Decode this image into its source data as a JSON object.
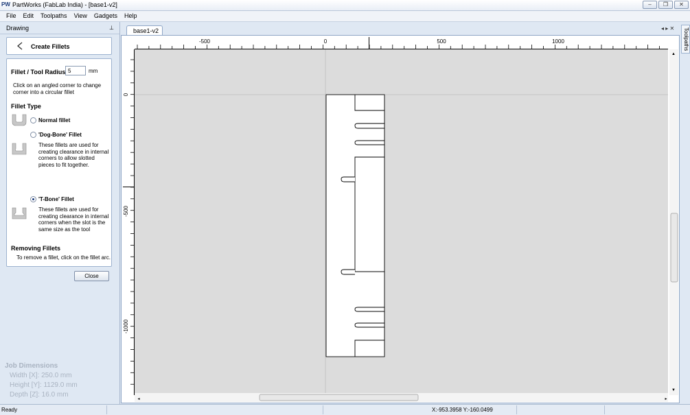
{
  "window": {
    "icon": "PW",
    "title": "PartWorks (FabLab India) - [base1-v2]",
    "buttons": [
      "–",
      "❐",
      "✕"
    ]
  },
  "menu": [
    "File",
    "Edit",
    "Toolpaths",
    "View",
    "Gadgets",
    "Help"
  ],
  "panel": {
    "header": "Drawing",
    "section_title": "Create Fillets",
    "radius_label": "Fillet / Tool Radius:",
    "radius_value": "5",
    "radius_unit": "mm",
    "instruction": "Click on an angled corner to change corner into a circular fillet",
    "fillet_type_title": "Fillet Type",
    "options": [
      {
        "label": "Normal fillet",
        "selected": false,
        "description": ""
      },
      {
        "label": "'Dog-Bone' Fillet",
        "selected": false,
        "description": "These fillets are used for creating clearance in internal corners to allow slotted pieces to fit together."
      },
      {
        "label": "'T-Bone' Fillet",
        "selected": true,
        "description": "These fillets are used for creating clearance in internal corners when the slot is the same size as the tool"
      }
    ],
    "removing_title": "Removing Fillets",
    "removing_text": "To remove a fillet, click on the fillet arc.",
    "close_label": "Close"
  },
  "job_dimensions": {
    "title": "Job Dimensions",
    "width": "Width  [X]: 250.0 mm",
    "height": "Height [Y]: 1129.0 mm",
    "depth": "Depth  [Z]: 16.0 mm"
  },
  "document_tab": "base1-v2",
  "tab_nav": "◂ ▸ ✕",
  "side_tab": "Toolpaths",
  "ruler": {
    "h_labels": [
      "-500",
      "0",
      "500",
      "1000"
    ],
    "v_labels": [
      "0",
      "-500",
      "-1000"
    ]
  },
  "status": {
    "text": "Ready",
    "coords": "X:-953.3958 Y:-160.0499"
  },
  "colors": {
    "canvas_bg": "#dcdcdc",
    "panel_bg": "#dfe8f3",
    "ruler_bg": "#ffffff",
    "part_outline": "#000000"
  },
  "icons": {
    "pin": "pin-icon",
    "back": "back-arrow-icon",
    "normal_fillet": "normal-fillet-icon",
    "dog_bone": "dog-bone-fillet-icon",
    "t_bone": "t-bone-fillet-icon"
  }
}
